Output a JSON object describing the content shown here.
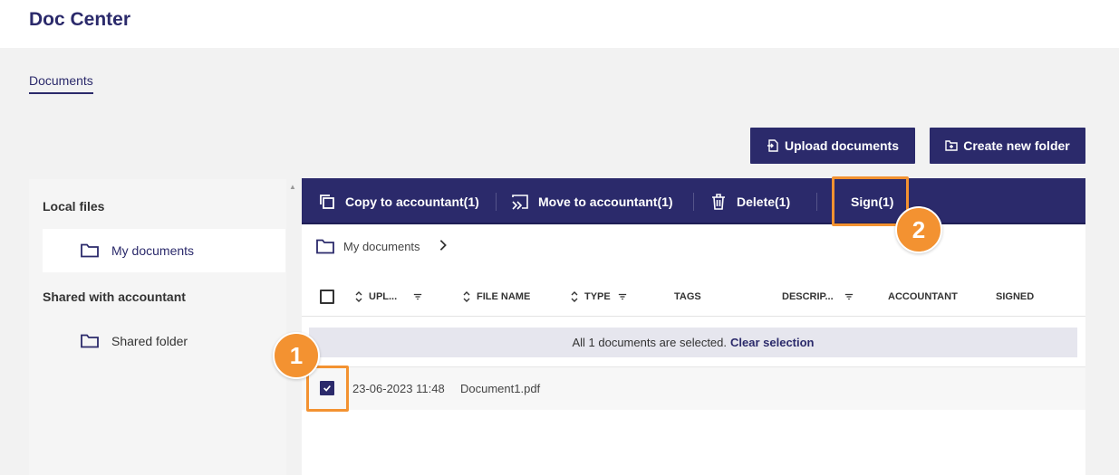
{
  "header": {
    "title": "Doc Center"
  },
  "tabs": [
    {
      "label": "Documents"
    }
  ],
  "toolbar": {
    "upload_label": "Upload documents",
    "create_folder_label": "Create new folder"
  },
  "sidebar": {
    "sections": [
      {
        "heading": "Local files",
        "items": [
          {
            "label": "My documents"
          }
        ]
      },
      {
        "heading": "Shared with accountant",
        "items": [
          {
            "label": "Shared folder"
          }
        ]
      }
    ]
  },
  "actions": {
    "copy": "Copy to accountant(1)",
    "move": "Move to accountant(1)",
    "delete": "Delete(1)",
    "sign": "Sign(1)"
  },
  "breadcrumb": {
    "folder": "My documents"
  },
  "table": {
    "columns": {
      "uploaded": "UPL...",
      "file_name": "FILE NAME",
      "type": "TYPE",
      "tags": "TAGS",
      "description": "DESCRIP...",
      "accountant": "ACCOUNTANT",
      "signed": "SIGNED"
    },
    "selection": {
      "message": "All 1 documents are selected.",
      "clear": "Clear selection"
    },
    "rows": [
      {
        "uploaded": "23-06-2023 11:48",
        "file_name": "Document1.pdf",
        "checked": true
      }
    ]
  },
  "annotations": {
    "step1": "1",
    "step2": "2"
  },
  "colors": {
    "primary": "#2b2a6b",
    "accent": "#f39231"
  }
}
